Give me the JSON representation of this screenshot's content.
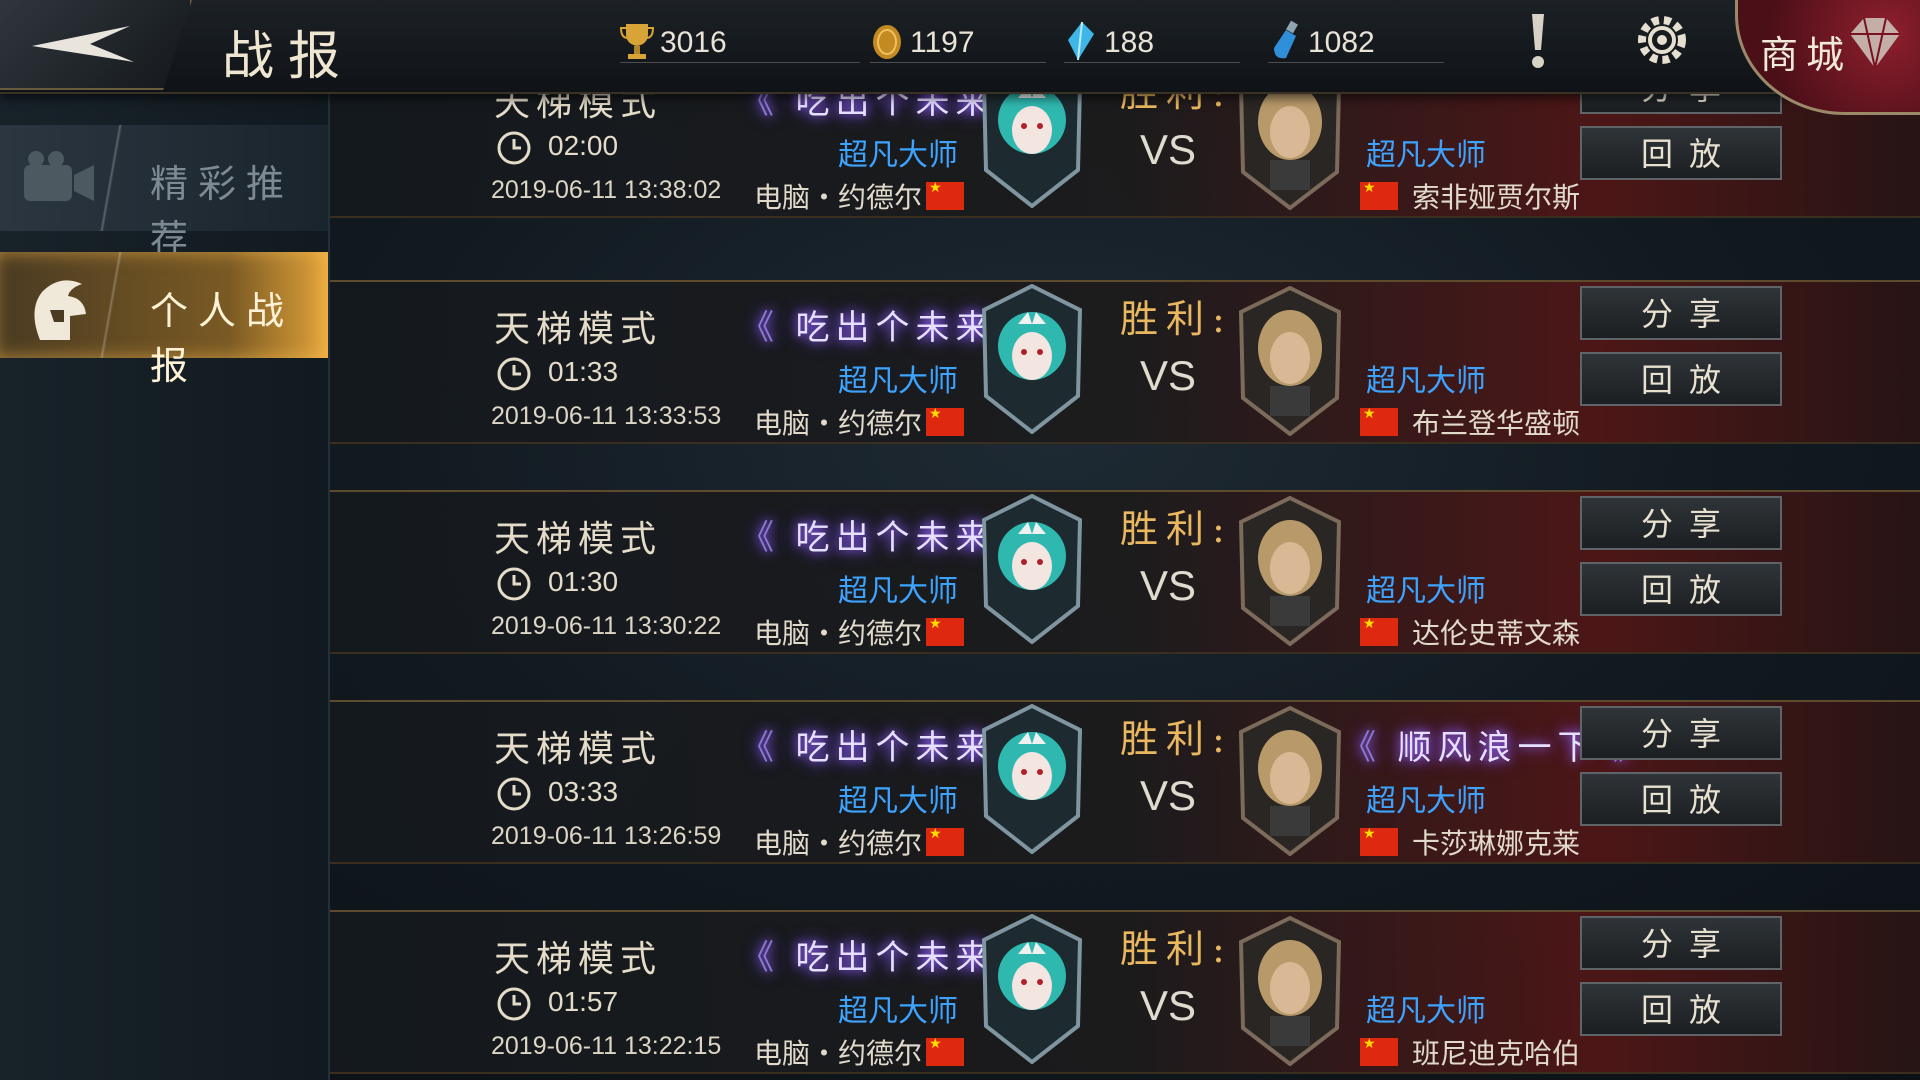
{
  "header": {
    "title": "战报"
  },
  "resources": [
    {
      "icon": "trophy-icon",
      "value": "3016"
    },
    {
      "icon": "gold-coin-icon",
      "value": "1197"
    },
    {
      "icon": "crystal-icon",
      "value": "188"
    },
    {
      "icon": "potion-icon",
      "value": "1082"
    }
  ],
  "shop": {
    "label": "商城"
  },
  "sidebar": {
    "items": [
      {
        "label": "精彩推荐"
      },
      {
        "label": "个人战报"
      }
    ]
  },
  "rows": [
    {
      "mode": "天梯模式",
      "duration": "02:00",
      "datetime": "2019-06-11  13:38:02",
      "left_guild": "吃出个未来",
      "left_rank": "超凡大师",
      "left_player": "电脑・约德尔",
      "result": "胜利:",
      "vs": "VS",
      "right_guild": "",
      "right_rank": "超凡大师",
      "right_player": "索非娅贾尔斯",
      "share": "分享",
      "replay": "回放"
    },
    {
      "mode": "天梯模式",
      "duration": "01:33",
      "datetime": "2019-06-11  13:33:53",
      "left_guild": "吃出个未来",
      "left_rank": "超凡大师",
      "left_player": "电脑・约德尔",
      "result": "胜利:",
      "vs": "VS",
      "right_guild": "",
      "right_rank": "超凡大师",
      "right_player": "布兰登华盛顿",
      "share": "分享",
      "replay": "回放"
    },
    {
      "mode": "天梯模式",
      "duration": "01:30",
      "datetime": "2019-06-11  13:30:22",
      "left_guild": "吃出个未来",
      "left_rank": "超凡大师",
      "left_player": "电脑・约德尔",
      "result": "胜利:",
      "vs": "VS",
      "right_guild": "",
      "right_rank": "超凡大师",
      "right_player": "达伦史蒂文森",
      "share": "分享",
      "replay": "回放"
    },
    {
      "mode": "天梯模式",
      "duration": "03:33",
      "datetime": "2019-06-11  13:26:59",
      "left_guild": "吃出个未来",
      "left_rank": "超凡大师",
      "left_player": "电脑・约德尔",
      "result": "胜利:",
      "vs": "VS",
      "right_guild": "顺风浪一下",
      "right_rank": "超凡大师",
      "right_player": "卡莎琳娜克莱",
      "share": "分享",
      "replay": "回放"
    },
    {
      "mode": "天梯模式",
      "duration": "01:57",
      "datetime": "2019-06-11  13:22:15",
      "left_guild": "吃出个未来",
      "left_rank": "超凡大师",
      "left_player": "电脑・约德尔",
      "result": "胜利:",
      "vs": "VS",
      "right_guild": "",
      "right_rank": "超凡大师",
      "right_player": "班尼迪克哈伯",
      "share": "分享",
      "replay": "回放"
    }
  ]
}
